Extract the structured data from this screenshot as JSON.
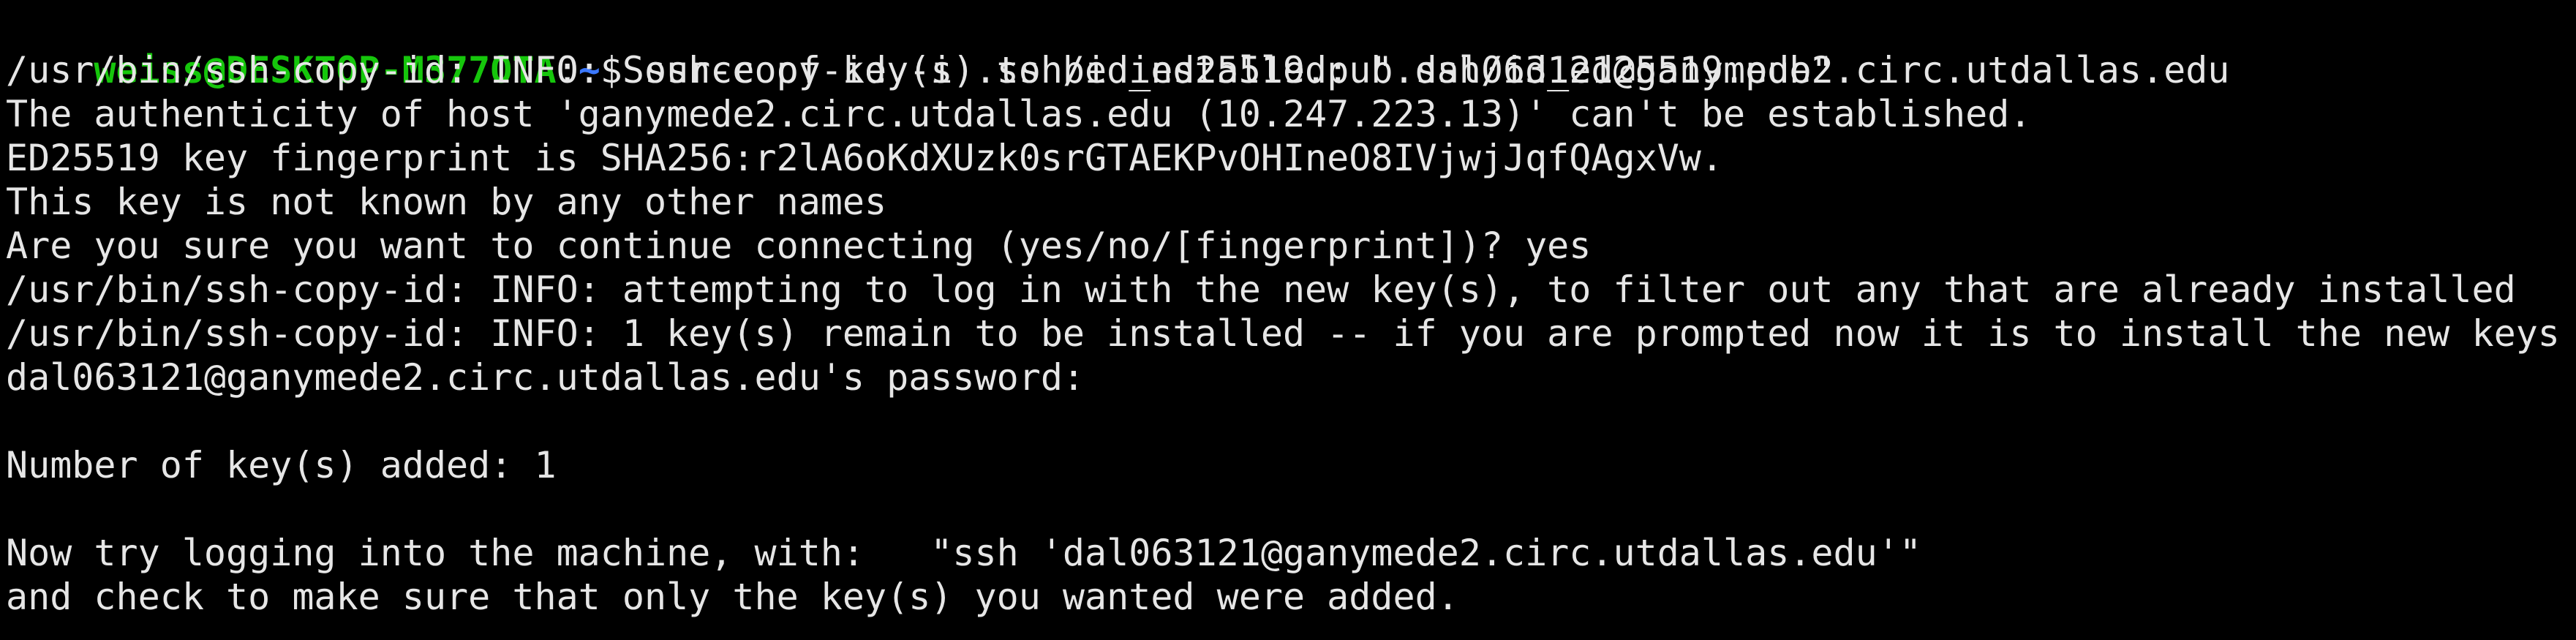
{
  "colors": {
    "background": "#000000",
    "foreground": "#e6e6e6",
    "prompt_user_host": "#16c60c",
    "prompt_path": "#3b78ff"
  },
  "prompt": {
    "user_host": "weiss@DESKTOP-M377OTA",
    "separator": ":",
    "path": "~",
    "symbol": "$ ",
    "command": "ssh-copy-id -i .ssh/id_ed25519.pub dal063121@ganymede2.circ.utdallas.edu"
  },
  "output_lines": [
    "/usr/bin/ssh-copy-id: INFO: Source of key(s) to be installed: \".ssh/id_ed25519.pub\"",
    "The authenticity of host 'ganymede2.circ.utdallas.edu (10.247.223.13)' can't be established.",
    "ED25519 key fingerprint is SHA256:r2lA6oKdXUzk0srGTAEKPvOHIneO8IVjwjJqfQAgxVw.",
    "This key is not known by any other names",
    "Are you sure you want to continue connecting (yes/no/[fingerprint])? yes",
    "/usr/bin/ssh-copy-id: INFO: attempting to log in with the new key(s), to filter out any that are already installed",
    "/usr/bin/ssh-copy-id: INFO: 1 key(s) remain to be installed -- if you are prompted now it is to install the new keys",
    "dal063121@ganymede2.circ.utdallas.edu's password:",
    "",
    "Number of key(s) added: 1",
    "",
    "Now try logging into the machine, with:   \"ssh 'dal063121@ganymede2.circ.utdallas.edu'\"",
    "and check to make sure that only the key(s) you wanted were added."
  ]
}
